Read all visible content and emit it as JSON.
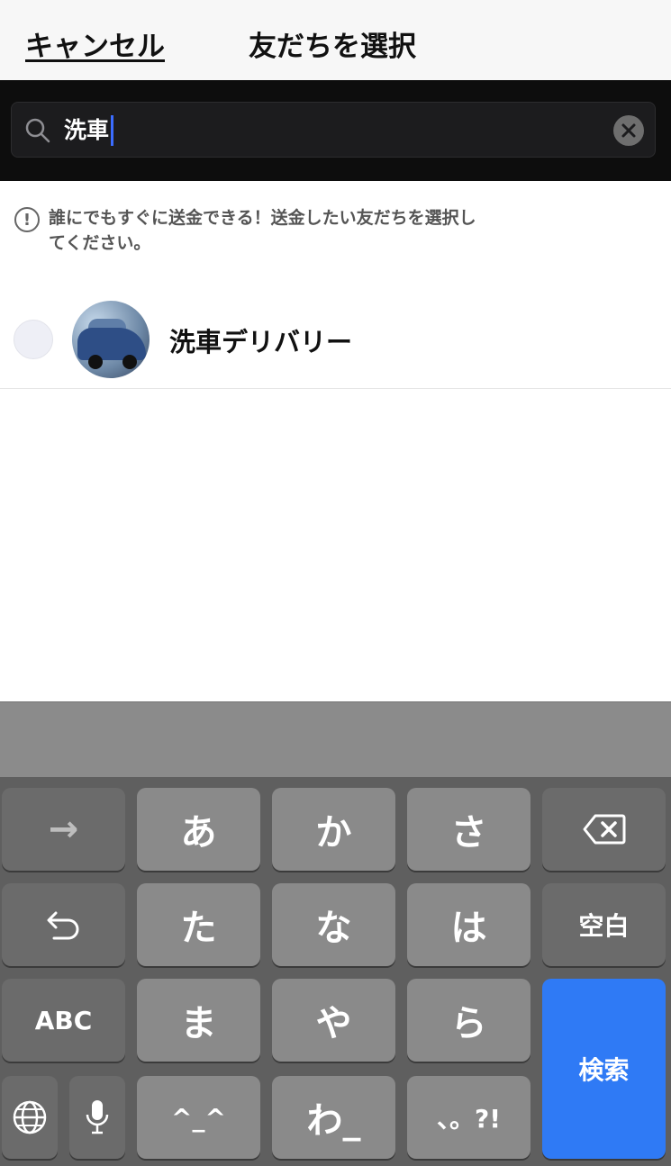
{
  "header": {
    "cancel_label": "キャンセル",
    "title": "友だちを選択"
  },
  "search": {
    "value": "洗車"
  },
  "notice": {
    "text_line1": "誰にでもすぐに送金できる！送金したい友だちを選択し",
    "text_line2": "てください。"
  },
  "friends": [
    {
      "name": "洗車デリバリー"
    }
  ],
  "keyboard": {
    "row1": [
      "→",
      "あ",
      "か",
      "さ",
      "⌫"
    ],
    "row2": [
      "↺",
      "た",
      "な",
      "は",
      "空白"
    ],
    "row3": [
      "ABC",
      "ま",
      "や",
      "ら"
    ],
    "row4": [
      "🌐",
      "🎤",
      "^_^",
      "わ_",
      "、。?!"
    ],
    "search_key": "検索"
  },
  "colors": {
    "accent": "#2f7af5",
    "caret": "#3b6cff"
  }
}
